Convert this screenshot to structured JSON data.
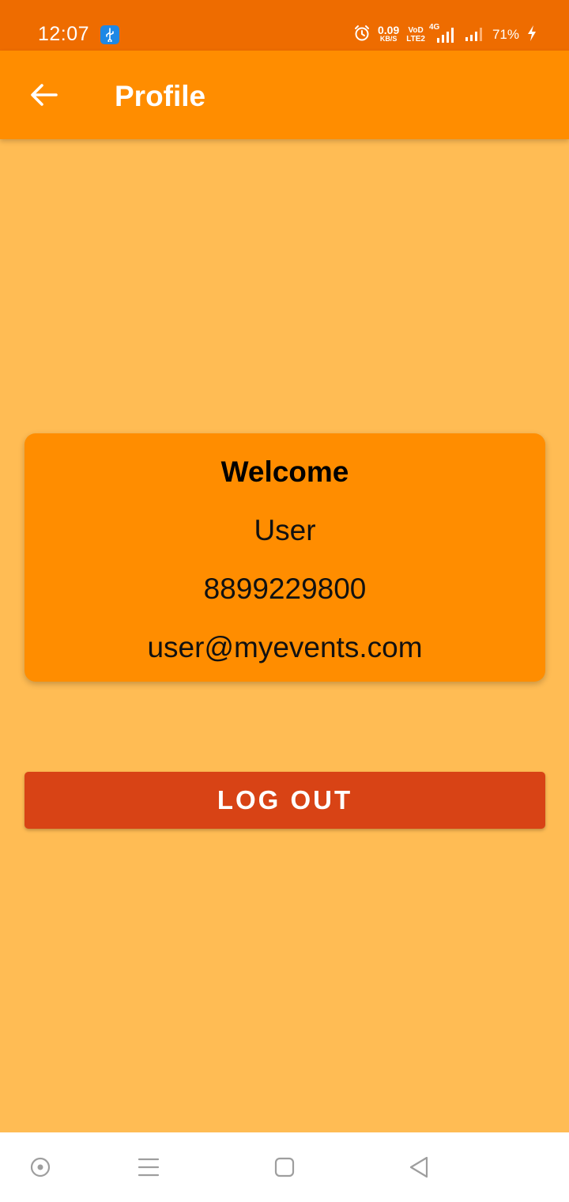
{
  "status_bar": {
    "time": "12:07",
    "speed_value": "0.09",
    "speed_unit": "KB/S",
    "volte_top": "VoD",
    "volte_bottom": "LTE2",
    "network_type": "4G",
    "battery": "71%",
    "icons": [
      "usb-icon",
      "alarm-icon",
      "signal-icon",
      "battery-charging-icon"
    ]
  },
  "app_bar": {
    "title": "Profile",
    "back_icon": "arrow-back-icon"
  },
  "profile": {
    "welcome": "Welcome",
    "name": "User",
    "phone": "8899229800",
    "email": "user@myevents.com"
  },
  "actions": {
    "logout_label": "LOG OUT"
  },
  "nav_bar": {
    "icons": [
      "assist-icon",
      "menu-icon",
      "home-icon",
      "back-icon"
    ]
  },
  "colors": {
    "status_bar": "#EE6C00",
    "app_bar": "#FF8D00",
    "background": "#FFBC54",
    "card": "#FF8D00",
    "logout_button": "#D84315"
  }
}
